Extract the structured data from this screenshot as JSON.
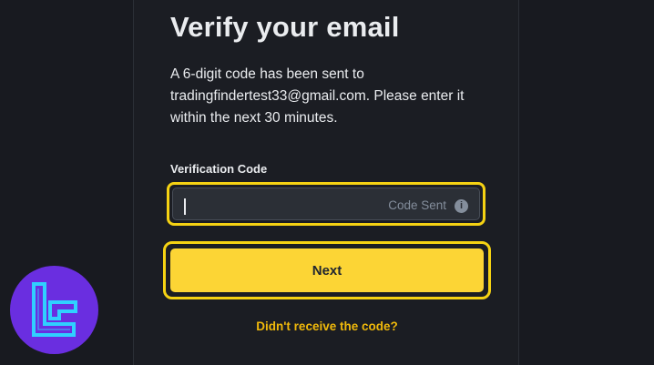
{
  "verify": {
    "title": "Verify your email",
    "description": "A 6-digit code has been sent to tradingfindertest33@gmail.com. Please enter it within the next 30 minutes.",
    "field_label": "Verification Code",
    "input_value": "",
    "code_sent_label": "Code Sent",
    "info_icon": "info-icon",
    "next_label": "Next",
    "resend_link": "Didn't receive the code?"
  },
  "logo": {
    "icon": "tradingfinder-logo",
    "background_color": "#6a2ee0",
    "mark_color": "#2fd0ff"
  },
  "colors": {
    "page_bg": "#181a20",
    "panel_bg": "#1b1d23",
    "highlight": "#f5d213",
    "button": "#fcd535",
    "link": "#f0b90b",
    "text": "#eaecef",
    "muted": "#848e9c"
  }
}
